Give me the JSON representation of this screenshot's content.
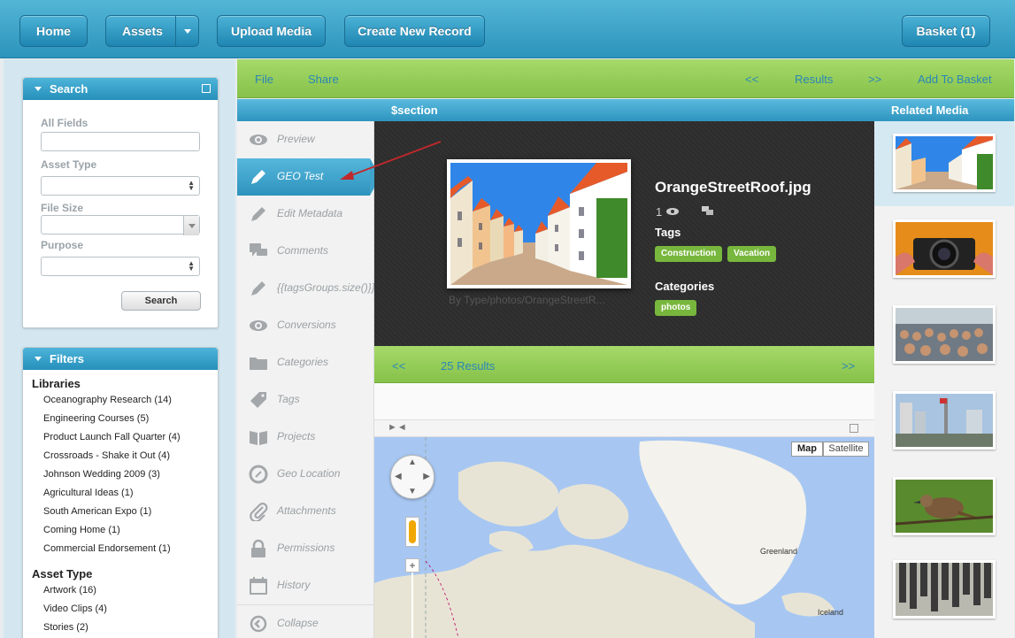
{
  "topnav": {
    "home": "Home",
    "assets": "Assets",
    "upload": "Upload Media",
    "create": "Create New Record",
    "basket": "Basket (1)"
  },
  "search_panel": {
    "title": "Search",
    "all_fields": "All Fields",
    "asset_type": "Asset Type",
    "file_size": "File Size",
    "purpose": "Purpose",
    "button": "Search"
  },
  "filters_panel": {
    "title": "Filters",
    "libraries_title": "Libraries",
    "libraries": [
      "Oceanography Research (14)",
      "Engineering Courses (5)",
      "Product Launch Fall Quarter (4)",
      "Crossroads - Shake it Out (4)",
      "Johnson Wedding 2009 (3)",
      "Agricultural Ideas (1)",
      "South American Expo (1)",
      "Coming Home (1)",
      "Commercial Endorsement (1)"
    ],
    "asset_type_title": "Asset Type",
    "asset_types": [
      "Artwork (16)",
      "Video Clips (4)",
      "Stories (2)"
    ]
  },
  "record_toolbar": {
    "file": "File",
    "share": "Share",
    "prev": "<<",
    "results": "Results",
    "next": ">>",
    "add_to_basket": "Add To Basket"
  },
  "section_bar": {
    "section": "$section",
    "related": "Related Media"
  },
  "side_menu": [
    {
      "label": "Preview",
      "icon": "eye-icon"
    },
    {
      "label": "GEO Test",
      "icon": "pencil-icon",
      "active": true
    },
    {
      "label": "Edit Metadata",
      "icon": "pencil-icon"
    },
    {
      "label": "Comments",
      "icon": "comments-icon"
    },
    {
      "label": "{{tagsGroups.size()}}",
      "icon": "pencil-icon"
    },
    {
      "label": "Conversions",
      "icon": "eye-icon"
    },
    {
      "label": "Categories",
      "icon": "folder-icon"
    },
    {
      "label": "Tags",
      "icon": "tag-icon"
    },
    {
      "label": "Projects",
      "icon": "book-icon"
    },
    {
      "label": "Geo Location",
      "icon": "compass-icon"
    },
    {
      "label": "Attachments",
      "icon": "paperclip-icon"
    },
    {
      "label": "Permissions",
      "icon": "lock-icon"
    },
    {
      "label": "History",
      "icon": "calendar-icon"
    },
    {
      "label": "Collapse",
      "icon": "collapse-icon"
    }
  ],
  "viewer": {
    "filename": "OrangeStreetRoof.jpg",
    "views": "1",
    "caption": "By Type/photos/OrangeStreetR...",
    "tags_label": "Tags",
    "tags": [
      "Construction",
      "Vacation"
    ],
    "categories_label": "Categories",
    "categories": [
      "photos"
    ]
  },
  "results_bar": {
    "prev": "<<",
    "count": "25 Results",
    "next": ">>"
  },
  "map": {
    "map_btn": "Map",
    "satellite_btn": "Satellite",
    "label_greenland": "Greenland",
    "label_iceland": "Iceland",
    "zoom_in": "+"
  },
  "colors": {
    "accent_blue": "#2e93bd",
    "accent_green": "#86c24a",
    "tag_green": "#78b73d"
  }
}
